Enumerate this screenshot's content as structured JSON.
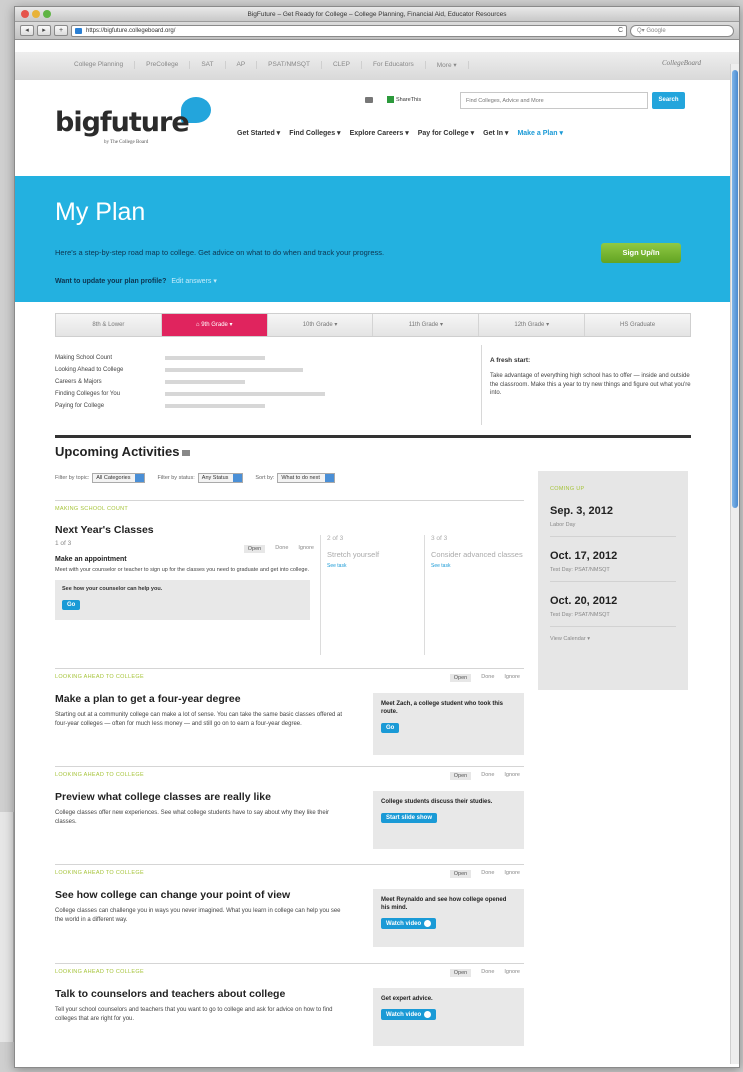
{
  "window": {
    "title": "BigFuture – Get Ready for College – College Planning, Financial Aid, Educator Resources",
    "url": "https://bigfuture.collegeboard.org/",
    "google_placeholder": "Q▾ Google",
    "back": "◂",
    "forward": "▸",
    "add": "+",
    "reload": "C"
  },
  "cbbar": {
    "links": [
      "College Planning",
      "PreCollege",
      "SAT",
      "AP",
      "PSAT/NMSQT",
      "CLEP",
      "For Educators",
      "More ▾"
    ],
    "logo": "CollegeBoard"
  },
  "header": {
    "logo": "bigfuture",
    "logo_sub": "by The College Board",
    "share_label": "ShareThis",
    "search_placeholder": "Find Colleges, Advice and More",
    "search_button": "Search",
    "nav": [
      "Get Started ▾",
      "Find Colleges ▾",
      "Explore Careers ▾",
      "Pay for College ▾",
      "Get In ▾"
    ],
    "nav_active": "Make a Plan ▾"
  },
  "hero": {
    "title": "My Plan",
    "description": "Here's a step-by-step road map to college. Get advice on what to do when and track your progress.",
    "update_question": "Want to update your plan profile?",
    "update_link": "Edit answers ▾",
    "signup": "Sign Up/In"
  },
  "grades": [
    {
      "label": "8th & Lower",
      "active": false
    },
    {
      "label": "⌂ 9th Grade ▾",
      "active": true
    },
    {
      "label": "10th Grade ▾",
      "active": false
    },
    {
      "label": "11th Grade ▾",
      "active": false
    },
    {
      "label": "12th Grade ▾",
      "active": false
    },
    {
      "label": "HS Graduate",
      "active": false
    }
  ],
  "progress": [
    {
      "label": "Making School Count"
    },
    {
      "label": "Looking Ahead to College"
    },
    {
      "label": "Careers & Majors"
    },
    {
      "label": "Finding Colleges for You"
    },
    {
      "label": "Paying for College"
    }
  ],
  "fresh_start": {
    "title": "A fresh start:",
    "text": "Take advantage of everything high school has to offer — inside and outside the classroom. Make this a year to try new things and figure out what you're into."
  },
  "activities": {
    "title": "Upcoming Activities",
    "filter_topic_label": "Filter by topic:",
    "filter_topic_value": "All Categories",
    "filter_status_label": "Filter by status:",
    "filter_status_value": "Any Status",
    "sort_label": "Sort by:",
    "sort_value": "What to do next"
  },
  "next_year": {
    "category": "MAKING SCHOOL COUNT",
    "title": "Next Year's Classes",
    "step": "1 of 3",
    "radios": [
      "Open",
      "Done",
      "Ignore"
    ],
    "task_title": "Make an appointment",
    "task_desc": "Meet with your counselor or teacher to sign up for the classes you need to graduate and get into college.",
    "box_text": "See how your counselor can help you.",
    "box_button": "Go",
    "step2": "2 of 3",
    "step2_title": "Stretch yourself",
    "step3": "3 of 3",
    "step3_title": "Consider advanced classes",
    "see_task": "See task"
  },
  "sections": [
    {
      "category": "LOOKING AHEAD TO COLLEGE",
      "title": "Make a plan to get a four-year degree",
      "desc": "Starting out at a community college can make a lot of sense. You can take the same basic classes offered at four-year colleges — often for much less money — and still go on to earn a four-year degree.",
      "box": "Meet Zach, a college student who took this route.",
      "button": "Go"
    },
    {
      "category": "LOOKING AHEAD TO COLLEGE",
      "title": "Preview what college classes are really like",
      "desc": "College classes offer new experiences. See what college students have to say about why they like their classes.",
      "box": "College students discuss their studies.",
      "button": "Start slide show"
    },
    {
      "category": "LOOKING AHEAD TO COLLEGE",
      "title": "See how college can change your point of view",
      "desc": "College classes can challenge you in ways you never imagined. What you learn in college can help you see the world in a different way.",
      "box": "Meet Reynaldo and see how college opened his mind.",
      "button": "Watch video"
    },
    {
      "category": "LOOKING AHEAD TO COLLEGE",
      "title": "Talk to counselors and teachers about college",
      "desc": "Tell your school counselors and teachers that you want to go to college and ask for advice on how to find colleges that are right for you.",
      "box": "Get expert advice.",
      "button": "Watch video"
    }
  ],
  "coming_up": {
    "heading": "COMING UP",
    "events": [
      {
        "date": "Sep. 3, 2012",
        "name": "Labor Day"
      },
      {
        "date": "Oct. 17, 2012",
        "name": "Test Day: PSAT/NMSQT"
      },
      {
        "date": "Oct. 20, 2012",
        "name": "Test Day: PSAT/NMSQT"
      }
    ],
    "view_calendar": "View Calendar ▾"
  },
  "colors": {
    "brand_blue": "#23b1e0",
    "active_pink": "#e0245e",
    "signup_green": "#6aab28",
    "category_green": "#a6c43a"
  }
}
